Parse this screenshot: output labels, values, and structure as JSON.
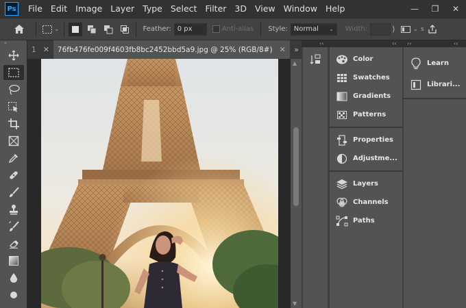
{
  "app": {
    "logo": "Ps"
  },
  "menu": [
    "File",
    "Edit",
    "Image",
    "Layer",
    "Type",
    "Select",
    "Filter",
    "3D",
    "View",
    "Window",
    "Help"
  ],
  "window_controls": {
    "minimize": "—",
    "restore": "❐",
    "close": "✕"
  },
  "options": {
    "feather_label": "Feather:",
    "feather_value": "0 px",
    "antialias_label": "Anti-alias",
    "style_label": "Style:",
    "style_value": "Normal",
    "width_label": "Width:"
  },
  "tabs": {
    "prev_tab_label": "1",
    "active_tab_label": "76fb476fe009f4603fb8bc2452bbd5a9.jpg @ 25% (RGB/8#)",
    "overflow": "»"
  },
  "panels": {
    "group1": [
      {
        "icon": "palette-icon",
        "label": "Color"
      },
      {
        "icon": "swatches-icon",
        "label": "Swatches"
      },
      {
        "icon": "gradients-icon",
        "label": "Gradients"
      },
      {
        "icon": "patterns-icon",
        "label": "Patterns"
      }
    ],
    "group2": [
      {
        "icon": "properties-icon",
        "label": "Properties"
      },
      {
        "icon": "adjustments-icon",
        "label": "Adjustme..."
      }
    ],
    "group3": [
      {
        "icon": "layers-icon",
        "label": "Layers"
      },
      {
        "icon": "channels-icon",
        "label": "Channels"
      },
      {
        "icon": "paths-icon",
        "label": "Paths"
      }
    ],
    "side": [
      {
        "icon": "learn-icon",
        "label": "Learn"
      },
      {
        "icon": "libraries-icon",
        "label": "Librari..."
      }
    ]
  },
  "colors": {
    "accent": "#31a8ff",
    "panel": "#535353",
    "menubar": "#323232"
  }
}
